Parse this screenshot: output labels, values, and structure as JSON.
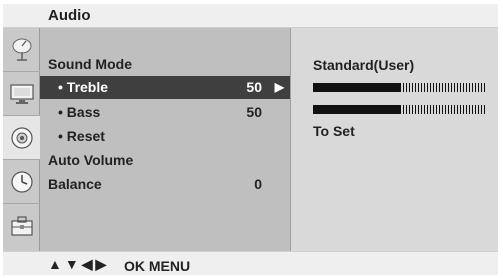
{
  "header": {
    "title": "Audio"
  },
  "sidebar": {
    "icons": [
      {
        "name": "satellite-dish-icon",
        "selected": false
      },
      {
        "name": "monitor-icon",
        "selected": false
      },
      {
        "name": "audio-disc-icon",
        "selected": true
      },
      {
        "name": "clock-icon",
        "selected": false
      },
      {
        "name": "toolbox-icon",
        "selected": false
      }
    ]
  },
  "menu": {
    "items": [
      {
        "label": "Sound Mode",
        "value": "",
        "level": "main",
        "highlight": false
      },
      {
        "label": "• Treble",
        "value": "50",
        "level": "sub",
        "highlight": true,
        "arrow": "▶"
      },
      {
        "label": "• Bass",
        "value": "50",
        "level": "sub",
        "highlight": false
      },
      {
        "label": "• Reset",
        "value": "",
        "level": "sub",
        "highlight": false
      },
      {
        "label": "Auto Volume",
        "value": "",
        "level": "main",
        "highlight": false
      },
      {
        "label": "Balance",
        "value": "0",
        "level": "main",
        "highlight": false
      }
    ]
  },
  "detail": {
    "title": "Standard(User)",
    "bars": [
      {
        "level": 0.5
      },
      {
        "level": 0.5
      }
    ],
    "to_set": "To Set"
  },
  "footer": {
    "nav_arrows": [
      "▲",
      "▼",
      "◀",
      "▶"
    ],
    "ok_menu": "OK  MENU"
  },
  "colors": {
    "highlight": "#3f3f3f",
    "menu_bg": "#bfbfbf",
    "detail_bg": "#d9d9d9"
  }
}
